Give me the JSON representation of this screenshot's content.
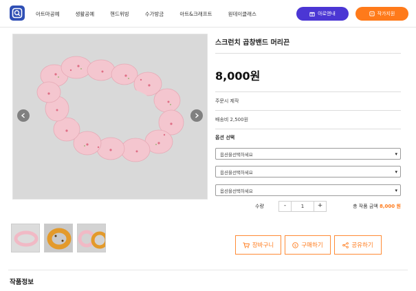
{
  "header": {
    "nav": [
      "아트마공예",
      "생활공예",
      "핸드위빙",
      "수가방금",
      "아트&크래프트",
      "원데이클래스"
    ],
    "btn_ilobe": "아로앤내",
    "btn_artist": "작가지원",
    "colors": {
      "ilobe": "#4b36d4",
      "artist": "#ff7a1a",
      "logo": "#2f4fb5"
    }
  },
  "product": {
    "title": "스크런치 곱창밴드 머리끈",
    "price": "8,000원",
    "made_to_order": "주문시 제작",
    "shipping": "배송비 2,500원",
    "option_label": "옵션 선택",
    "options": [
      "옵션을선택하세요",
      "옵션을선택하세요",
      "옵션을선택하세요"
    ],
    "qty_label": "수량",
    "qty_minus": "-",
    "qty_value": "1",
    "qty_plus": "+",
    "total_label": "총 작품 금액",
    "total_amount": "8,000 원",
    "accent": "#ff7a1a"
  },
  "actions": {
    "cart": "장바구니",
    "buy": "구매하기",
    "share": "공유하기"
  },
  "section": {
    "title": "작품정보"
  }
}
